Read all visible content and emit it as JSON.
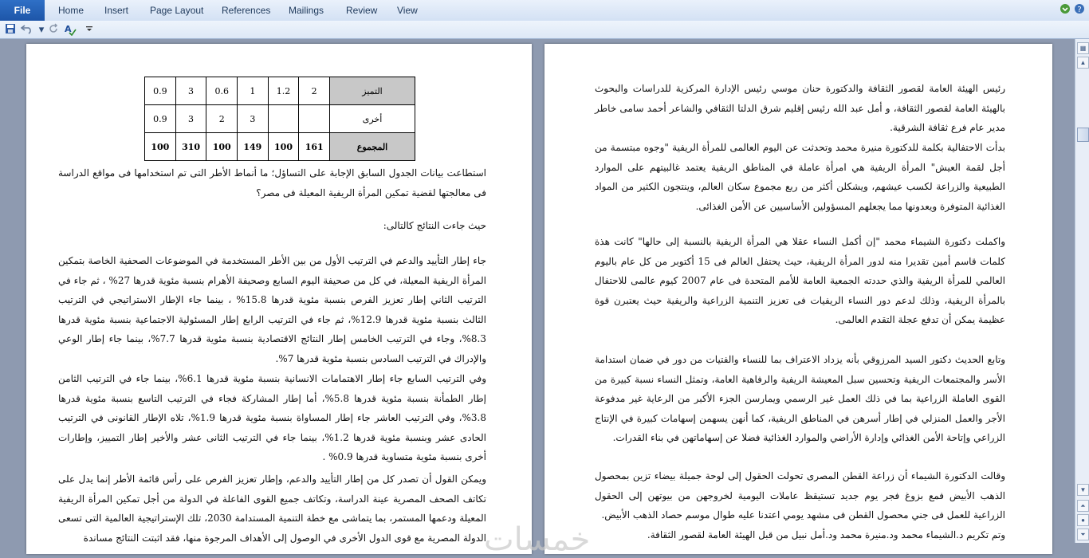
{
  "ribbon": {
    "file_label": "File",
    "tabs": [
      "Home",
      "Insert",
      "Page Layout",
      "References",
      "Mailings",
      "Review",
      "View"
    ]
  },
  "qat": {
    "icons": [
      "save-icon",
      "undo-icon",
      "redo-icon",
      "spelling-icon",
      "customize-qat-icon"
    ]
  },
  "window": {
    "icons": [
      "help-icon",
      "minimize-icon"
    ]
  },
  "table": {
    "rows": [
      {
        "label": "التميز",
        "cells": [
          "2",
          "1.2",
          "1",
          "0.6",
          "3",
          "0.9"
        ]
      },
      {
        "label": "أخرى",
        "cells": [
          "",
          "",
          "3",
          "2",
          "3",
          "0.9"
        ]
      },
      {
        "label": "المجموع",
        "cells": [
          "161",
          "100",
          "149",
          "100",
          "310",
          "100"
        ]
      }
    ]
  },
  "left_page": {
    "p1": "استطاعت بيانات الجدول السابق الإجابة على التساؤل؛ ما أنماط الأطر التى تم استخدامها فى مواقع الدراسة فى معالجتها لقضية تمكين المرأة الريفية المعيلة فى مصر؟",
    "p2": "حيث جاءت النتائج كالتالى:",
    "p3": "جاء إطار التأييد والدعم في الترتيب الأول من بين الأطر المستخدمة في الموضوعات الصحفية الخاصة بتمكين المرأة الريفية المعيلة، في كل من صحيفة اليوم السابع وصحيفة الأهرام بنسبة مئوية قدرها 27% ، ثم جاء في الترتيب الثاني إطار تعزيز الفرص بنسبة مئوية قدرها 15.8% ، بينما جاء الإطار الاستراتيجي في الترتيب الثالث بنسبة مئوية قدرها 12.9%، ثم جاء في الترتيب الرابع إطار المسئولية الاجتماعية بنسبة مئوية قدرها 8.3%، وجاء في الترتيب الخامس إطار النتائج الاقتصادية بنسبة مئوية قدرها 7.7%، بينما جاء إطار الوعي والإدراك في الترتيب السادس بنسبة مئوية قدرها 7%.",
    "p4": "وفي الترتيب السابع جاء إطار الاهتمامات الانسانية بنسبة مئوية قدرها 6.1%، بينما جاء في الترتيب الثامن إطار الطمأنة بنسبة مئوية قدرها 5.8%، أما إطار المشاركة فجاء في الترتيب التاسع بنسبة مئوية قدرها 3.8%، وفي الترتيب العاشر جاء إطار المساواة بنسبة مئوية قدرها 1.9%، تلاه الإطار القانونى في الترتيب الحادى عشر وبنسبة مئوية قدرها 1.2%، بينما جاء في الترتيب الثانى عشر والأخير إطار التمييز، وإطارات أخرى بنسبة مئوية متساوية قدرها 0.9% .",
    "p5": "ويمكن القول أن تصدر كل من إطار التأييد والدعم، وإطار تعزيز الفرص على رأس قائمة الأطر إنما يدل على تكاتف الصحف المصرية عينة الدراسة، وتكاتف جميع القوى الفاعلة في الدولة من أجل تمكين المرأة الريفية المعيلة ودعمها المستمر، بما يتماشى مع خطة التنمية المستدامة 2030، تلك الإستراتيجية العالمية التى تسعى الدولة المصرية مع قوى الدول الأخرى في الوصول إلى الأهداف المرجوة منها، فقد اثبتت النتائج مساندة"
  },
  "right_page": {
    "p1": "رئيس الهيئة العامة لقصور الثقافة والدكتورة حنان موسي رئيس الإدارة المركزية للدراسات والبحوث بالهيئة العامة لقصور الثقافة، و أمل عبد الله رئيس إقليم شرق الدلتا الثقافي والشاعر أحمد سامى خاطر مدير عام فرع ثقافة الشرقية.",
    "p2": "بدأت الاحتفالية بكلمة للدكتورة منيرة محمد وتحدثت عن اليوم العالمى للمرأة الريفية \"وجوه مبتسمة من أجل لقمة العيش\" المرأة الريفية هي امرأة عاملة في المناطق الريفية يعتمد غالبيتهم على الموارد الطبيعية والزراعة لكسب عيشهم، ويشكلن أكثر من ربع مجموع سكان العالم، وينتجون الكثير من المواد الغذائية المتوفرة ويعدونها مما يجعلهم المسؤولين الأساسيين عن الأمن الغذائى.",
    "p3": "واكملت دكتورة الشيماء محمد \"إن أكمل النساء عقلا هي المرأة الريفية بالنسبة إلى حالها\" كانت هذة كلمات قاسم أمين تقديرا منه لدور المرأة الريفية، حيث يحتفل العالم فى 15 أكتوبر من كل عام باليوم العالمي للمرأة الريفية والذي حددته الجمعية العامة للأمم المتحدة فى عام 2007 كيوم عالمى للاحتفال بالمرأة الريفية، وذلك لدعم دور النساء الريفيات فى تعزيز التنمية الزراعية والريفية حيث يعتبرن قوة عظيمة يمكن أن تدفع عجلة التقدم العالمى.",
    "p4": "وتابع الحديث دكتور السيد المرزوقي بأنه يزداد الاعتراف بما للنساء والفتيات من دور في ضمان استدامة الأسر والمجتمعات الريفية وتحسين سبل المعيشة الريفية والرفاهية العامة، وتمثل النساء نسبة كبيرة من القوى العاملة الزراعية بما في ذلك العمل غير الرسمي ويمارسن الجزء الأكبر من الرعاية غير مدفوعة الأجر والعمل المنزلي في إطار أسرهن في المناطق الريفية، كما أنهن يسهمن إسهامات كبيرة في الإنتاج الزراعي وإتاحة الأمن الغذائي وإدارة الأراضي والموارد الغذائية فضلا عن إسهاماتهن في بناء القدرات.",
    "p5": "وقالت الدكتورة الشيماء أن زراعة القطن المصرى تحولت الحقول إلى لوحة جميلة بيضاء تزين بمحصول الذهب الأبيض فمع بزوغ فجر يوم جديد تستيقظ عاملات اليومية لخروجهن من بيوتهن إلى الحقول الزراعية للعمل فى جني محصول القطن فى مشهد يومي اعتدنا عليه طوال موسم حصاد الذهب الأبيض.",
    "p6": "وتم تكريم د.الشيماء محمد ود.منيرة محمد ود.أمل نبيل من قبل الهيئة العامة لقصور الثقافة."
  },
  "watermark": "خمسات"
}
